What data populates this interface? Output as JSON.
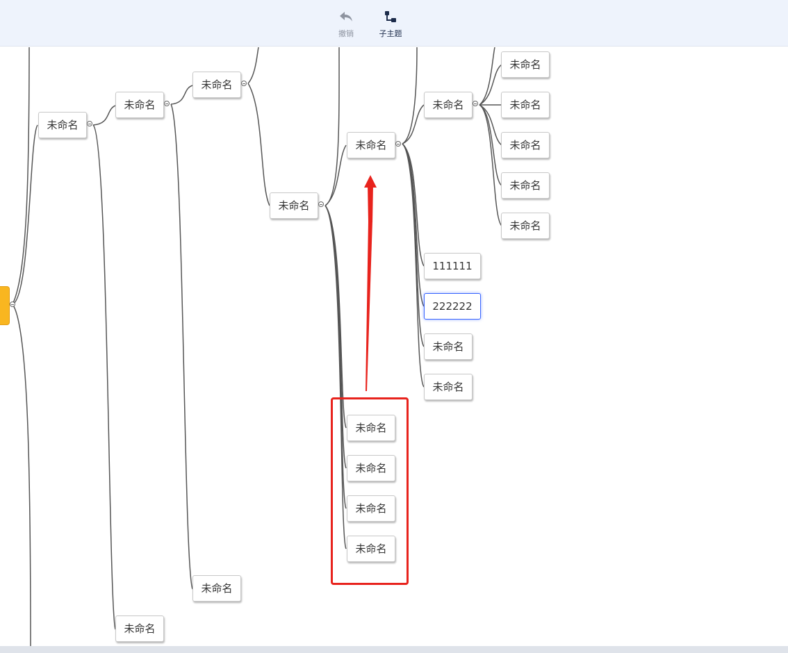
{
  "toolbar": {
    "undo": {
      "label": "撤销",
      "icon": "undo-arrow-icon"
    },
    "subtopic": {
      "label": "子主题",
      "icon": "subtopic-tree-icon"
    }
  },
  "mindmap": {
    "root": {
      "color": "#f9b620"
    },
    "nodes": [
      {
        "id": "n1",
        "label": "未命名"
      },
      {
        "id": "n2",
        "label": "未命名"
      },
      {
        "id": "n3",
        "label": "未命名"
      },
      {
        "id": "n4",
        "label": "未命名"
      },
      {
        "id": "n5",
        "label": "未命名"
      },
      {
        "id": "n6",
        "label": "未命名"
      },
      {
        "id": "n7",
        "label": "未命名"
      },
      {
        "id": "n8",
        "label": "未命名"
      },
      {
        "id": "n9",
        "label": "未命名"
      },
      {
        "id": "n10",
        "label": "未命名"
      },
      {
        "id": "n11",
        "label": "未命名"
      },
      {
        "id": "n12",
        "label": "111111"
      },
      {
        "id": "n13",
        "label": "222222",
        "selected": true
      },
      {
        "id": "n14",
        "label": "未命名"
      },
      {
        "id": "n15",
        "label": "未命名"
      },
      {
        "id": "n16",
        "label": "未命名"
      },
      {
        "id": "n17",
        "label": "未命名"
      },
      {
        "id": "n18",
        "label": "未命名"
      },
      {
        "id": "n19",
        "label": "未命名"
      },
      {
        "id": "n20",
        "label": "未命名"
      },
      {
        "id": "n21",
        "label": "未命名"
      }
    ]
  },
  "annotation": {
    "color": "#e8231d"
  }
}
